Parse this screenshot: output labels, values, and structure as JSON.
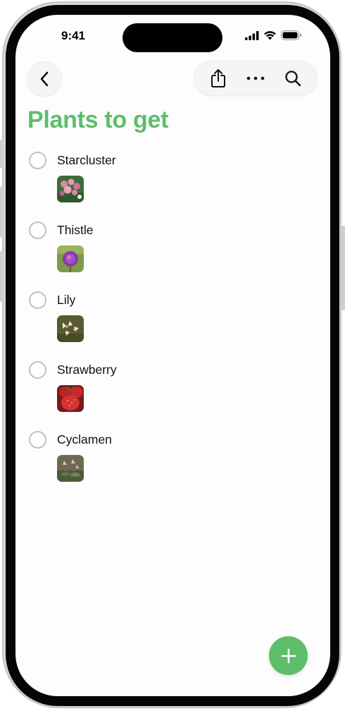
{
  "status_bar": {
    "time": "9:41"
  },
  "header": {
    "back_icon": "chevron-left-icon",
    "toolbar_icons": [
      "share-icon",
      "more-icon",
      "search-icon"
    ]
  },
  "page": {
    "title": "Plants to get"
  },
  "colors": {
    "accent": "#5ebd6b",
    "checkbox_border": "#c2c2c6"
  },
  "items": [
    {
      "label": "Starcluster",
      "checked": false,
      "image": "starcluster-photo"
    },
    {
      "label": "Thistle",
      "checked": false,
      "image": "thistle-photo"
    },
    {
      "label": "Lily",
      "checked": false,
      "image": "lily-photo"
    },
    {
      "label": "Strawberry",
      "checked": false,
      "image": "strawberry-photo"
    },
    {
      "label": "Cyclamen",
      "checked": false,
      "image": "cyclamen-photo"
    }
  ],
  "fab": {
    "icon": "plus-icon"
  }
}
